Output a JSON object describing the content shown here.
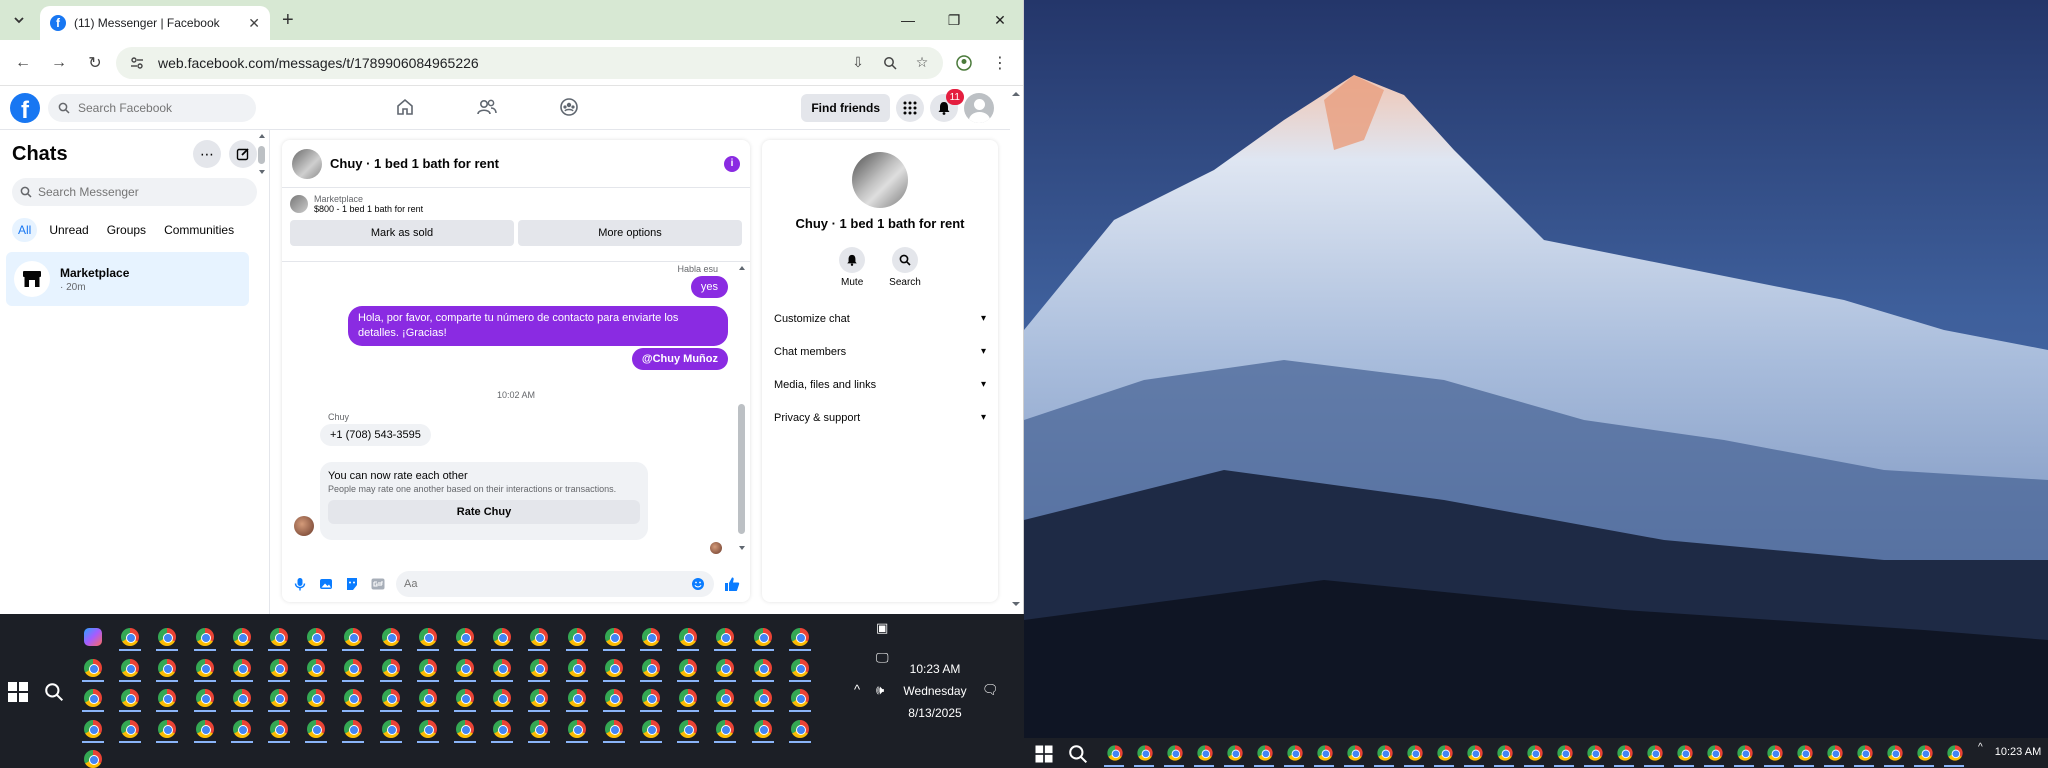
{
  "browser": {
    "tab_title": "(11) Messenger | Facebook",
    "url": "web.facebook.com/messages/t/1789906084965226"
  },
  "facebook": {
    "search_placeholder": "Search Facebook",
    "find_friends_label": "Find friends",
    "notification_count": "11"
  },
  "chats": {
    "title": "Chats",
    "search_placeholder": "Search Messenger",
    "filters": [
      "All",
      "Unread",
      "Groups",
      "Communities"
    ],
    "conversation": {
      "name": "Marketplace",
      "time": "· 20m"
    }
  },
  "conversation": {
    "title": "Chuy · 1 bed 1 bath for rent",
    "marketplace_label": "Marketplace",
    "listing": "$800 - 1 bed 1 bath for rent",
    "mark_sold_label": "Mark as sold",
    "more_options_label": "More options",
    "messages": {
      "partial_text": "Habla esu",
      "msg_yes": "yes",
      "msg_contact": "Hola, por favor, comparte tu número de contacto para enviarte los detalles. ¡Gracias!",
      "msg_mention": "@Chuy Muñoz",
      "timestamp": "10:02 AM",
      "sender": "Chuy",
      "phone": "+1 (708) 543-3595",
      "rate_title": "You can now rate each other",
      "rate_subtitle": "People may rate one another based on their interactions or transactions.",
      "rate_button": "Rate Chuy"
    },
    "composer_placeholder": "Aa"
  },
  "details": {
    "title": "Chuy · 1 bed 1 bath for rent",
    "mute_label": "Mute",
    "search_label": "Search",
    "items": [
      "Customize chat",
      "Chat members",
      "Media, files and links",
      "Privacy & support"
    ]
  },
  "taskbar": {
    "time": "10:23 AM",
    "day": "Wednesday",
    "date": "8/13/2025",
    "right_time": "10:23 AM"
  },
  "colors": {
    "facebook_blue": "#1877f2",
    "message_purple": "#8a2be2",
    "taskbar": "#1c1f26",
    "tabbar": "#d7e8d3"
  }
}
